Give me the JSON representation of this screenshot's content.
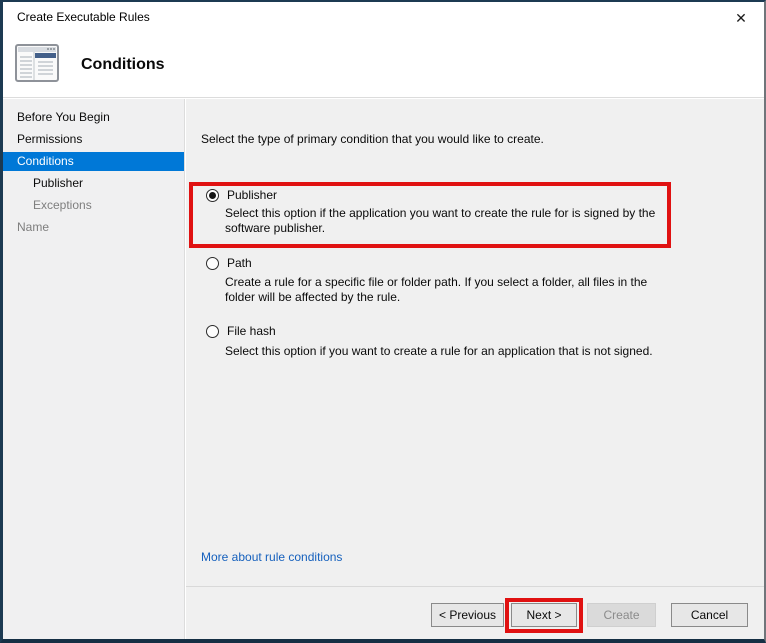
{
  "window": {
    "title": "Create Executable Rules",
    "close_glyph": "✕"
  },
  "header": {
    "title": "Conditions"
  },
  "sidebar": {
    "items": [
      {
        "label": "Before You Begin",
        "state": "normal"
      },
      {
        "label": "Permissions",
        "state": "normal"
      },
      {
        "label": "Conditions",
        "state": "selected"
      },
      {
        "label": "Publisher",
        "state": "sub"
      },
      {
        "label": "Exceptions",
        "state": "sub-disabled"
      },
      {
        "label": "Name",
        "state": "disabled"
      }
    ]
  },
  "main": {
    "intro": "Select the type of primary condition that you would like to create.",
    "options": [
      {
        "label": "Publisher",
        "description": "Select this option if the application you want to create the rule for is signed by the software publisher.",
        "selected": true,
        "highlighted": true
      },
      {
        "label": "Path",
        "description": "Create a rule for a specific file or folder path. If you select a folder, all files in the folder will be affected by the rule.",
        "selected": false,
        "highlighted": false
      },
      {
        "label": "File hash",
        "description": "Select this option if you want to create a rule for an application that is not signed.",
        "selected": false,
        "highlighted": false
      }
    ],
    "link": "More about rule conditions"
  },
  "footer": {
    "buttons": [
      {
        "label": "< Previous",
        "enabled": true,
        "highlighted": false
      },
      {
        "label": "Next >",
        "enabled": true,
        "highlighted": true
      },
      {
        "label": "Create",
        "enabled": false,
        "highlighted": false
      },
      {
        "label": "Cancel",
        "enabled": true,
        "highlighted": false
      }
    ]
  },
  "colors": {
    "accent": "#0078d7",
    "highlight_red": "#e01111",
    "link_blue": "#1560bd"
  }
}
